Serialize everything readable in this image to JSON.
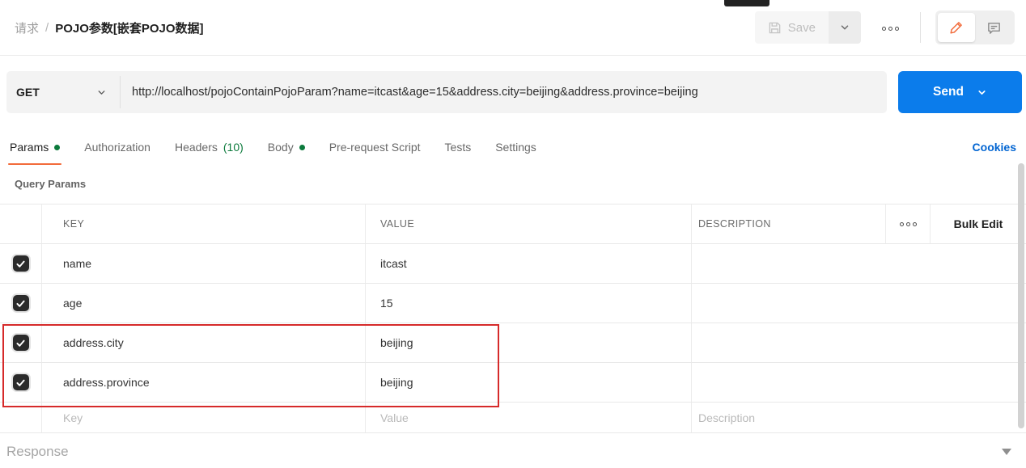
{
  "header": {
    "breadcrumb": {
      "section": "请求",
      "separator": "/",
      "title": "POJO参数[嵌套POJO数据]"
    },
    "save_button": {
      "label": "Save"
    },
    "icons": {
      "save": "floppy-disk-icon",
      "save_menu": "chevron-down-icon",
      "more": "three-dots-icon",
      "edit": "pencil-icon",
      "comment": "speech-bubble-icon"
    }
  },
  "request_bar": {
    "method": "GET",
    "url": "http://localhost/pojoContainPojoParam?name=itcast&age=15&address.city=beijing&address.province=beijing",
    "send_label": "Send"
  },
  "tabs": [
    {
      "label": "Params",
      "active": true,
      "has_dot": true
    },
    {
      "label": "Authorization",
      "active": false
    },
    {
      "label": "Headers",
      "badge": "(10)",
      "active": false
    },
    {
      "label": "Body",
      "active": false,
      "has_dot": true
    },
    {
      "label": "Pre-request Script",
      "active": false
    },
    {
      "label": "Tests",
      "active": false
    },
    {
      "label": "Settings",
      "active": false
    }
  ],
  "cookies_link": "Cookies",
  "params_section": {
    "title": "Query Params",
    "columns": {
      "key": "KEY",
      "value": "VALUE",
      "description": "DESCRIPTION"
    },
    "bulk_edit_label": "Bulk Edit",
    "rows": [
      {
        "checked": true,
        "key": "name",
        "value": "itcast",
        "description": ""
      },
      {
        "checked": true,
        "key": "age",
        "value": "15",
        "description": ""
      },
      {
        "checked": true,
        "key": "address.city",
        "value": "beijing",
        "description": "",
        "annotated": true
      },
      {
        "checked": true,
        "key": "address.province",
        "value": "beijing",
        "description": "",
        "annotated": true
      }
    ],
    "placeholder_row": {
      "key": "Key",
      "value": "Value",
      "description": "Description"
    }
  },
  "response_section": {
    "label": "Response"
  },
  "colors": {
    "send_blue": "#0b7ceb",
    "cookies_blue": "#0265d2",
    "accent_orange": "#f26b3a",
    "dot_green": "#0c7a3c",
    "annotation_red": "#d62a2a",
    "checkbox_dark": "#2b2b2b",
    "bar_gray": "#f3f3f3"
  }
}
